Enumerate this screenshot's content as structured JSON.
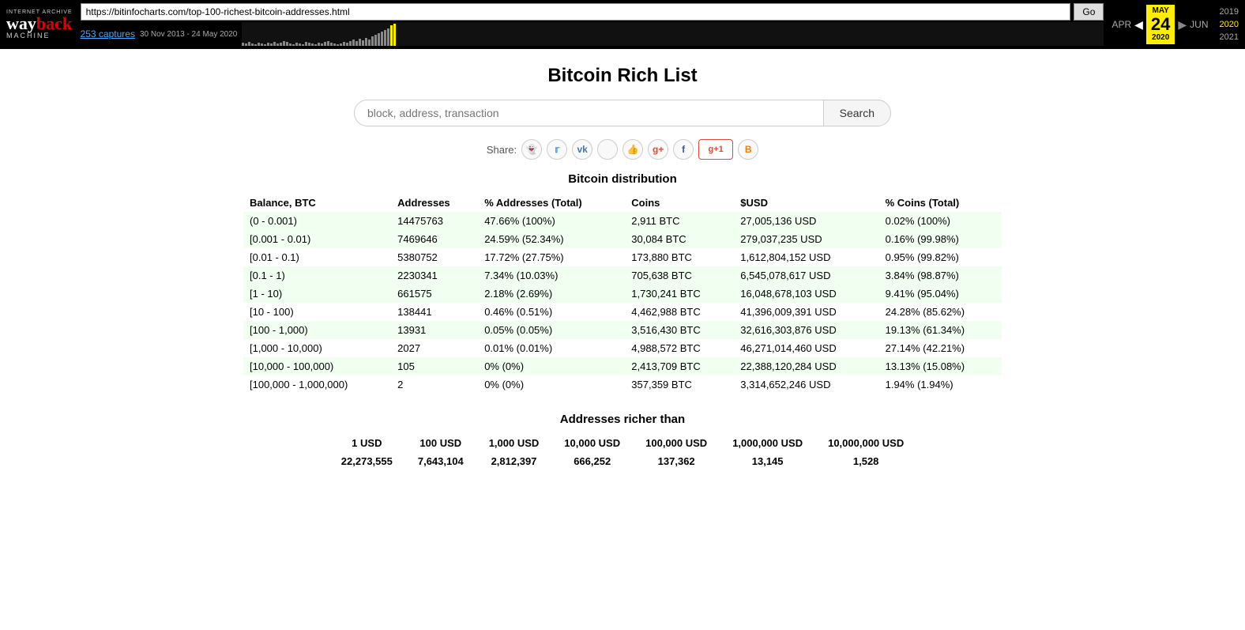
{
  "wayback": {
    "internet_archive_label": "INTERNET ARCHIVE",
    "wayback_label": "wayback",
    "machine_label": "Machine",
    "url": "https://bitinfocharts.com/top-100-richest-bitcoin-addresses.html",
    "go_label": "Go",
    "captures_link": "253 captures",
    "captures_date": "30 Nov 2013 - 24 May 2020",
    "year_prev": "APR",
    "year_active": "MAY\n24\n2020",
    "year_next": "JUN",
    "year_2019": "2019",
    "year_2020": "2020",
    "year_2021": "2021"
  },
  "page": {
    "title": "Bitcoin Rich List",
    "search_placeholder": "block, address, transaction",
    "search_button": "Search"
  },
  "share": {
    "label": "Share:"
  },
  "distribution": {
    "section_title": "Bitcoin distribution",
    "columns": [
      "Balance, BTC",
      "Addresses",
      "% Addresses (Total)",
      "Coins",
      "$USD",
      "% Coins (Total)"
    ],
    "rows": [
      {
        "balance": "(0 - 0.001)",
        "addresses": "14475763",
        "pct_addr": "47.66% (100%)",
        "coins": "2,911 BTC",
        "usd": "27,005,136 USD",
        "pct_coins": "0.02% (100%)",
        "highlight": true
      },
      {
        "balance": "[0.001 - 0.01)",
        "addresses": "7469646",
        "pct_addr": "24.59% (52.34%)",
        "coins": "30,084 BTC",
        "usd": "279,037,235 USD",
        "pct_coins": "0.16% (99.98%)",
        "highlight": true
      },
      {
        "balance": "[0.01 - 0.1)",
        "addresses": "5380752",
        "pct_addr": "17.72% (27.75%)",
        "coins": "173,880 BTC",
        "usd": "1,612,804,152 USD",
        "pct_coins": "0.95% (99.82%)",
        "highlight": false
      },
      {
        "balance": "[0.1 - 1)",
        "addresses": "2230341",
        "pct_addr": "7.34% (10.03%)",
        "coins": "705,638 BTC",
        "usd": "6,545,078,617 USD",
        "pct_coins": "3.84% (98.87%)",
        "highlight": true
      },
      {
        "balance": "[1 - 10)",
        "addresses": "661575",
        "pct_addr": "2.18% (2.69%)",
        "coins": "1,730,241 BTC",
        "usd": "16,048,678,103 USD",
        "pct_coins": "9.41% (95.04%)",
        "highlight": true
      },
      {
        "balance": "[10 - 100)",
        "addresses": "138441",
        "pct_addr": "0.46% (0.51%)",
        "coins": "4,462,988 BTC",
        "usd": "41,396,009,391 USD",
        "pct_coins": "24.28% (85.62%)",
        "highlight": false
      },
      {
        "balance": "[100 - 1,000)",
        "addresses": "13931",
        "pct_addr": "0.05% (0.05%)",
        "coins": "3,516,430 BTC",
        "usd": "32,616,303,876 USD",
        "pct_coins": "19.13% (61.34%)",
        "highlight": true
      },
      {
        "balance": "[1,000 - 10,000)",
        "addresses": "2027",
        "pct_addr": "0.01% (0.01%)",
        "coins": "4,988,572 BTC",
        "usd": "46,271,014,460 USD",
        "pct_coins": "27.14% (42.21%)",
        "highlight": false
      },
      {
        "balance": "[10,000 - 100,000)",
        "addresses": "105",
        "pct_addr": "0% (0%)",
        "coins": "2,413,709 BTC",
        "usd": "22,388,120,284 USD",
        "pct_coins": "13.13% (15.08%)",
        "highlight": true
      },
      {
        "balance": "[100,000 - 1,000,000)",
        "addresses": "2",
        "pct_addr": "0% (0%)",
        "coins": "357,359 BTC",
        "usd": "3,314,652,246 USD",
        "pct_coins": "1.94% (1.94%)",
        "highlight": false
      }
    ]
  },
  "richer": {
    "section_title": "Addresses richer than",
    "columns": [
      "1 USD",
      "100 USD",
      "1,000 USD",
      "10,000 USD",
      "100,000 USD",
      "1,000,000 USD",
      "10,000,000 USD"
    ],
    "values": [
      "22,273,555",
      "7,643,104",
      "2,812,397",
      "666,252",
      "137,362",
      "13,145",
      "1,528"
    ]
  }
}
